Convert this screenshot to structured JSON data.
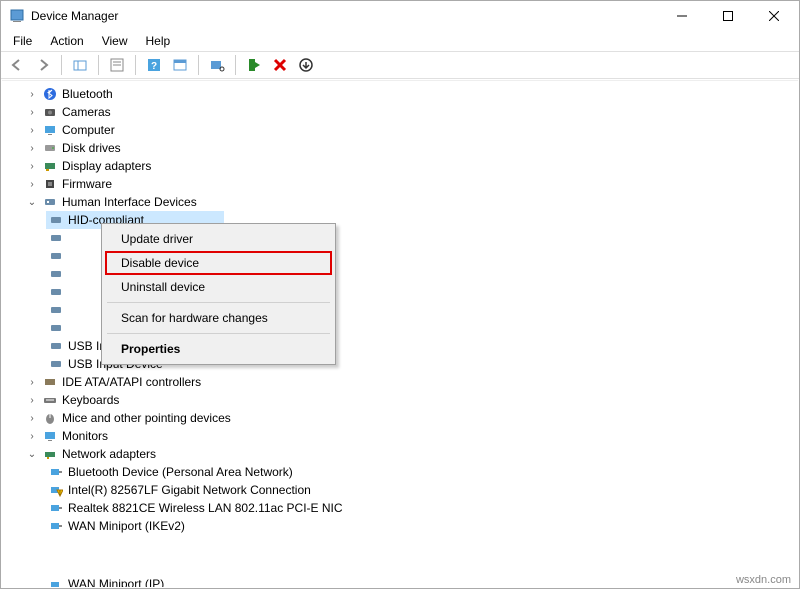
{
  "window": {
    "title": "Device Manager"
  },
  "menu": {
    "file": "File",
    "action": "Action",
    "view": "View",
    "help": "Help"
  },
  "tree": {
    "bluetooth": "Bluetooth",
    "cameras": "Cameras",
    "computer": "Computer",
    "disk_drives": "Disk drives",
    "display_adapters": "Display adapters",
    "firmware": "Firmware",
    "hid": "Human Interface Devices",
    "hid_selected": "HID-compliant",
    "usb_input_1": "USB Input Device",
    "usb_input_2": "USB Input Device",
    "ide": "IDE ATA/ATAPI controllers",
    "keyboards": "Keyboards",
    "mice": "Mice and other pointing devices",
    "monitors": "Monitors",
    "network": "Network adapters",
    "net_bt": "Bluetooth Device (Personal Area Network)",
    "net_intel": "Intel(R) 82567LF Gigabit Network Connection",
    "net_realtek": "Realtek 8821CE Wireless LAN 802.11ac PCI-E NIC",
    "net_wan_ikev2": "WAN Miniport (IKEv2)",
    "net_wan_ip": "WAN Miniport (IP)"
  },
  "context": {
    "update": "Update driver",
    "disable": "Disable device",
    "uninstall": "Uninstall device",
    "scan": "Scan for hardware changes",
    "properties": "Properties"
  },
  "watermark": "wsxdn.com"
}
